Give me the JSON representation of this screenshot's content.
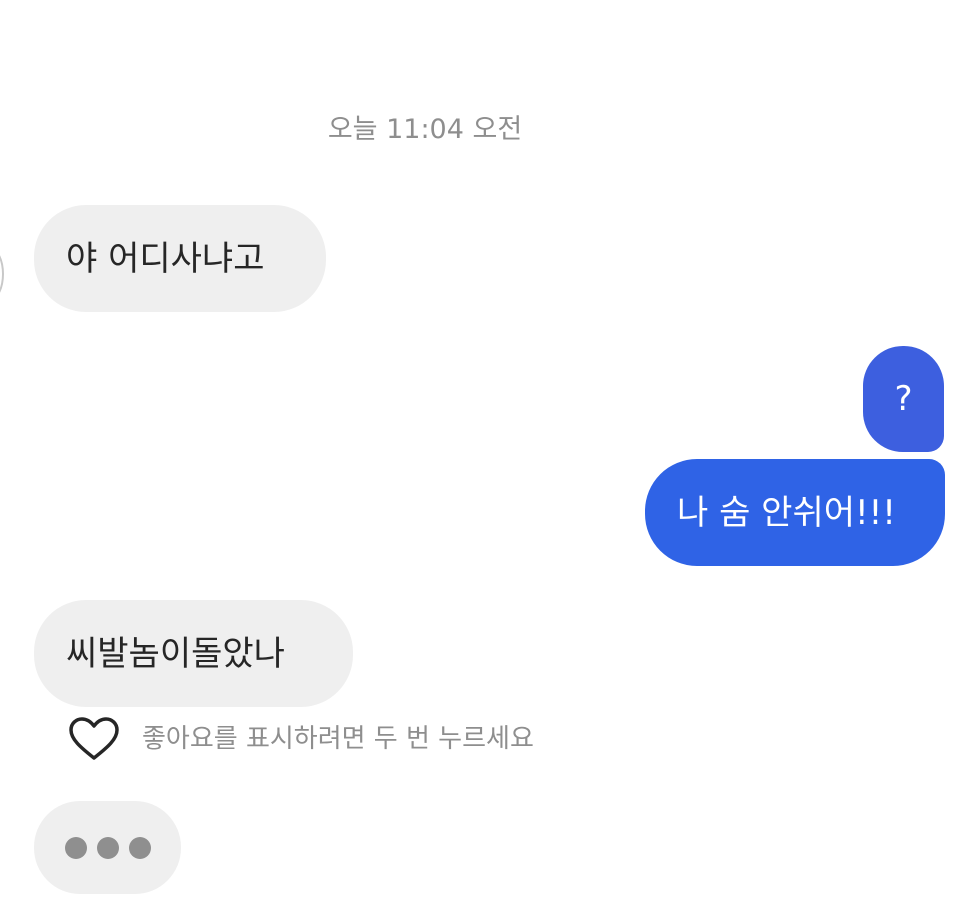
{
  "thread": {
    "timestamp": "오늘 11:04 오전",
    "messages": [
      {
        "sender": "them",
        "text": "야 어디사냐고"
      },
      {
        "sender": "me",
        "text": "?"
      },
      {
        "sender": "me",
        "text": "나 숨 안쉬어!!!"
      },
      {
        "sender": "them",
        "text": "씨발놈이돌았나"
      }
    ],
    "like_hint": "좋아요를 표시하려면 두 번 누르세요"
  },
  "icons": {
    "like": "heart-outline-icon",
    "typing": "typing-dots-icon"
  },
  "colors": {
    "incoming_bubble": "#efefef",
    "outgoing_bubble": "#2f63e6",
    "outgoing_bubble_top": "#3d5fdf",
    "meta_text": "#8e8e8e"
  }
}
